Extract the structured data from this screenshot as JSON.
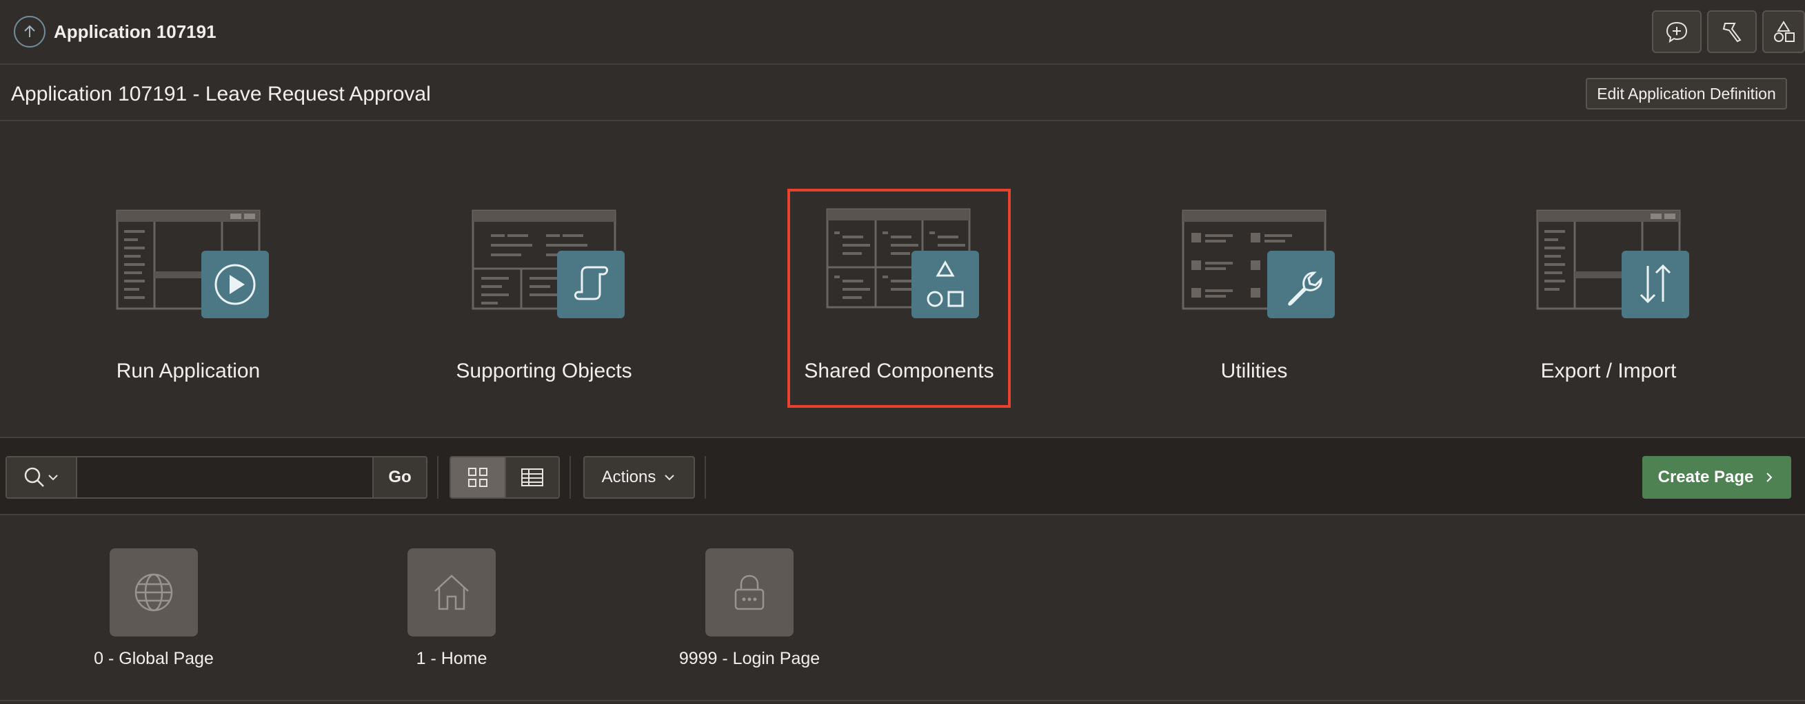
{
  "topbar": {
    "app_name": "Application 107191",
    "buttons": [
      "feedback-icon",
      "flashlight-icon",
      "shapes-icon"
    ]
  },
  "header": {
    "title": "Application 107191 - Leave Request Approval",
    "edit_button": "Edit Application Definition"
  },
  "dashboard": {
    "tiles": [
      {
        "label": "Run Application",
        "icon": "play-icon"
      },
      {
        "label": "Supporting Objects",
        "icon": "scroll-icon"
      },
      {
        "label": "Shared Components",
        "icon": "shapes-icon",
        "highlighted": true
      },
      {
        "label": "Utilities",
        "icon": "wrench-icon"
      },
      {
        "label": "Export / Import",
        "icon": "arrows-up-down-icon"
      }
    ]
  },
  "toolbar": {
    "search_value": "",
    "go_label": "Go",
    "actions_label": "Actions",
    "create_label": "Create Page"
  },
  "pages": [
    {
      "label": "0 - Global Page",
      "icon": "globe-icon"
    },
    {
      "label": "1 - Home",
      "icon": "home-icon"
    },
    {
      "label": "9999 - Login Page",
      "icon": "lock-icon"
    }
  ],
  "colors": {
    "background": "#312d2a",
    "tile_badge": "#4c7785",
    "highlight": "#e8422f",
    "create_button": "#4f8253"
  }
}
